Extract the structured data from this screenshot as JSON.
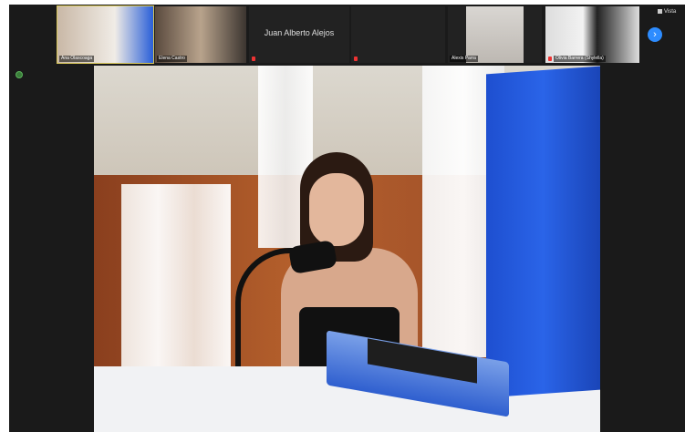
{
  "participants": [
    {
      "name": "Ana Olascoaga",
      "active": true
    },
    {
      "name": "Elena Castro"
    },
    {
      "name": "Juan Alberto Alejos",
      "no_video": true
    },
    {
      "name": "",
      "no_video": true
    },
    {
      "name": "Alexis Parra"
    },
    {
      "name": "Olivia Barrera (Shylella)"
    }
  ],
  "view_button": {
    "label": "Vista"
  },
  "next_page_icon": "chevron-right-icon",
  "colors": {
    "accent": "#2d8cff",
    "background": "#1a1a1a",
    "muted_mic": "#e33333",
    "active_border": "#d9c85a"
  }
}
